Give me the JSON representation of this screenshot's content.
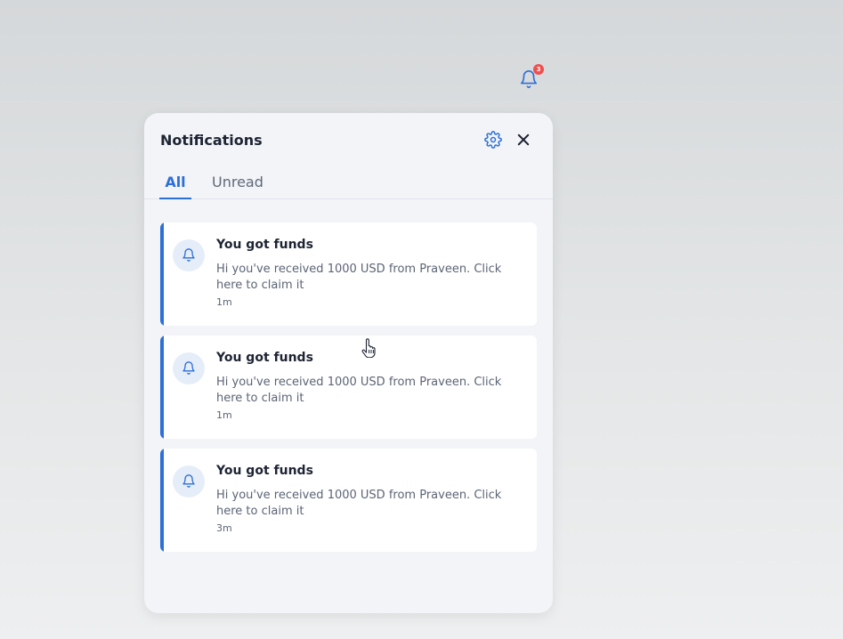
{
  "header": {
    "bell_icon": "bell-icon",
    "badge_count": "3"
  },
  "panel": {
    "title": "Notifications",
    "settings_icon": "gear-icon",
    "close_icon": "close-icon",
    "tabs": [
      {
        "label": "All",
        "active": true
      },
      {
        "label": "Unread",
        "active": false
      }
    ],
    "notifications": [
      {
        "title": "You got funds",
        "message": "Hi you've received 1000 USD from Praveen. Click here to claim it",
        "time": "1m",
        "icon": "bell-icon"
      },
      {
        "title": "You got funds",
        "message": "Hi you've received 1000 USD from Praveen. Click here to claim it",
        "time": "1m",
        "icon": "bell-icon"
      },
      {
        "title": "You got funds",
        "message": "Hi you've received 1000 USD from Praveen. Click here to claim it",
        "time": "3m",
        "icon": "bell-icon"
      }
    ]
  },
  "colors": {
    "accent": "#2d6fd8",
    "badge": "#ee4f4f",
    "panel_background": "#f2f4f8",
    "text_primary": "#1d2433",
    "text_secondary": "#5b6475"
  }
}
